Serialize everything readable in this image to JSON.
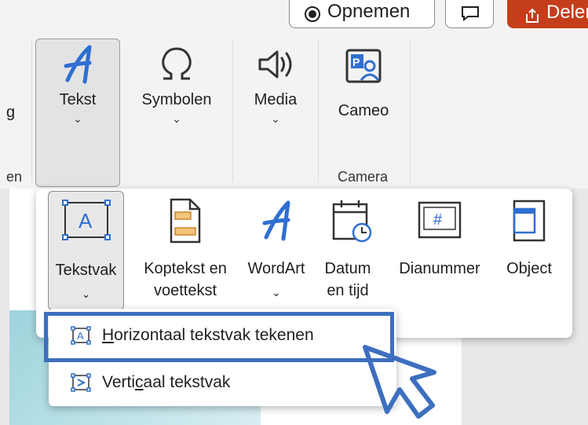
{
  "top": {
    "record_label": "Opnemen",
    "share_label": "Delen"
  },
  "ribbon": {
    "partial_left_label": "g",
    "partial_left_group": "en",
    "tekst_label": "Tekst",
    "symbolen_label": "Symbolen",
    "media_label": "Media",
    "cameo_label": "Cameo",
    "camera_group_label": "Camera"
  },
  "panel": {
    "tekstvak_label": "Tekstvak",
    "koptekst_line1": "Koptekst en",
    "koptekst_line2": "voettekst",
    "wordart_label": "WordArt",
    "datum_line1": "Datum",
    "datum_line2": "en tijd",
    "dianummer_label": "Dianummer",
    "object_label": "Object"
  },
  "submenu": {
    "horizontal_first": "H",
    "horizontal_rest": "orizontaal tekstvak tekenen",
    "vertical_pre": "Verti",
    "vertical_underline": "c",
    "vertical_post": "aal tekstvak"
  },
  "colors": {
    "accent": "#3d6fbf",
    "share_button": "#c43e1c",
    "icon_blue": "#2f6fd1"
  },
  "icons": [
    "wordart-a-icon",
    "omega-icon",
    "speaker-icon",
    "cameo-icon",
    "textbox-icon",
    "header-footer-icon",
    "calendar-clock-icon",
    "slide-number-icon",
    "object-icon",
    "cursor-icon"
  ]
}
